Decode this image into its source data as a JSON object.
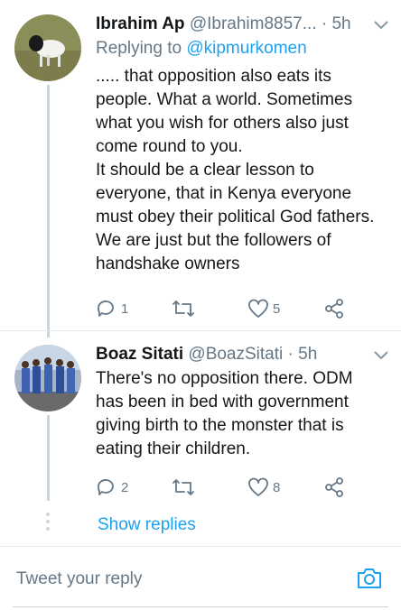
{
  "tweets": [
    {
      "name": "Ibrahim Ap",
      "handle": "@Ibrahim8857...",
      "separator": "·",
      "time": "5h",
      "replying_label": "Replying to",
      "replying_to": "@kipmurkomen",
      "body": [
        "..... that opposition also eats its people. What a world. Sometimes what you wish for others also just come round to you.",
        "It should be a clear lesson to everyone, that in Kenya everyone must obey their political God fathers. We are just but the followers of handshake owners"
      ],
      "replies": "1",
      "retweets": "",
      "likes": "5",
      "avatar_icon": "goat-photo"
    },
    {
      "name": "Boaz Sitati",
      "handle": "@BoazSitati",
      "separator": "·",
      "time": "5h",
      "body": [
        "There's no opposition there. ODM has been in bed with government giving birth to the monster that is eating their children."
      ],
      "replies": "2",
      "retweets": "",
      "likes": "8",
      "avatar_icon": "group-photo"
    }
  ],
  "show_replies": "Show replies",
  "composer": {
    "placeholder": "Tweet your reply",
    "camera_icon": "camera-icon"
  },
  "colors": {
    "accent": "#1da1f2",
    "secondary_text": "#657786",
    "thread_line": "#ccd6dd"
  }
}
